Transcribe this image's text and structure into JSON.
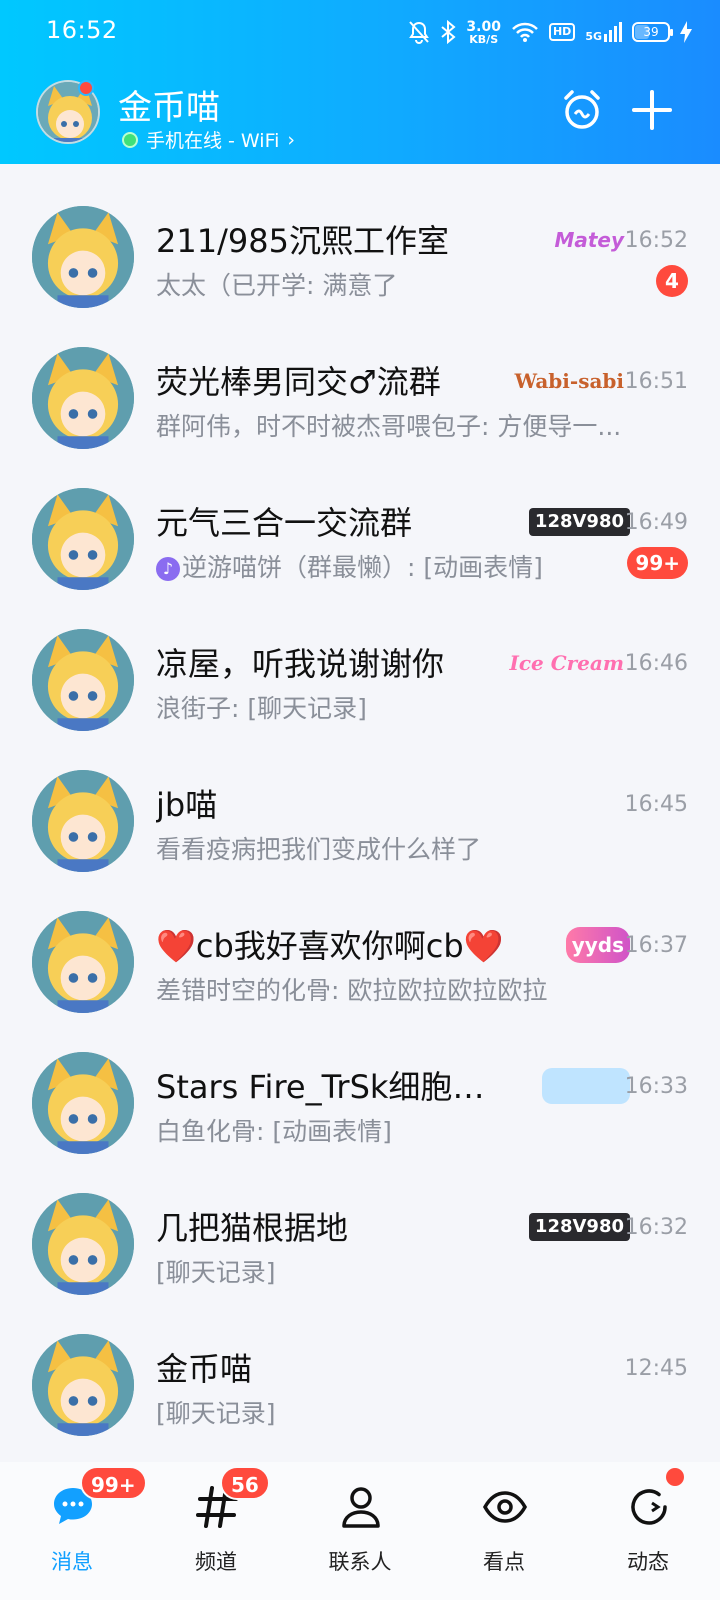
{
  "status_bar": {
    "time": "16:52",
    "speed_value": "3.00",
    "speed_unit": "KB/S",
    "hd": "HD",
    "network": "5G",
    "battery": "39"
  },
  "profile": {
    "name": "金币喵",
    "status": "手机在线 - WiFi",
    "chevron": "›"
  },
  "chats": [
    {
      "title": "211/985沉熙工作室",
      "preview": "太太（已开学: 满意了",
      "time": "16:52",
      "tag": "Matey",
      "badge": "4"
    },
    {
      "title": "荧光棒男同交♂流群",
      "preview": "群阿伟，时不时被杰哥喂包子: 方便导一...",
      "time": "16:51",
      "tag": "Wabi-sabi",
      "badge": ""
    },
    {
      "title": "元气三合一交流群",
      "preview": "逆游喵饼（群最懒）: [动画表情]",
      "time": "16:49",
      "tag": "128V980",
      "badge": "99+"
    },
    {
      "title": "凉屋，听我说谢谢你",
      "preview": "浪街子: [聊天记录]",
      "time": "16:46",
      "tag": "Ice Cream",
      "badge": ""
    },
    {
      "title": "jb喵",
      "preview": "看看疫病把我们变成什么样了",
      "time": "16:45",
      "tag": "",
      "badge": ""
    },
    {
      "title": "❤️cb我好喜欢你啊cb❤️",
      "preview": "差错时空的化骨: 欧拉欧拉欧拉欧拉",
      "time": "16:37",
      "tag": "yyds",
      "badge": ""
    },
    {
      "title": "Stars Fire_TrSk细胞加...",
      "preview": "白鱼化骨: [动画表情]",
      "time": "16:33",
      "tag": "",
      "badge": ""
    },
    {
      "title": "几把猫根据地",
      "preview": "[聊天记录]",
      "time": "16:32",
      "tag": "128V980",
      "badge": ""
    },
    {
      "title": "金币喵",
      "preview": "[聊天记录]",
      "time": "12:45",
      "tag": "",
      "badge": ""
    }
  ],
  "nav": {
    "messages": {
      "label": "消息",
      "badge": "99+"
    },
    "channels": {
      "label": "频道",
      "badge": "56"
    },
    "contacts": {
      "label": "联系人"
    },
    "discover": {
      "label": "看点"
    },
    "moments": {
      "label": "动态"
    }
  },
  "colors": {
    "accent": "#12a0ff",
    "badge_red": "#ff4a3d",
    "header_start": "#00c8ff",
    "header_end": "#1a8cff"
  }
}
